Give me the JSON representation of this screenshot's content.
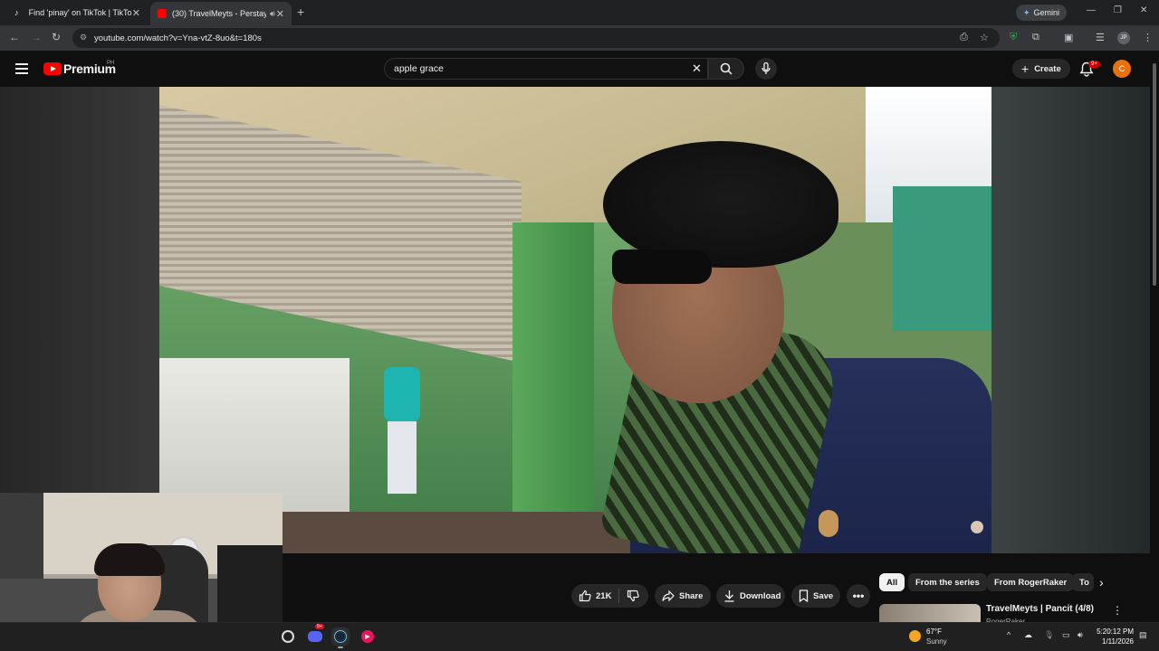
{
  "browser": {
    "tabs": [
      {
        "title": "Find 'pinay' on TikTok | TikTok S",
        "icon": "tiktok-icon",
        "active": false
      },
      {
        "title": "(30) TravelMeyts - Perstaym",
        "icon": "youtube-icon",
        "active": true
      }
    ],
    "gemini_label": "Gemini",
    "url": "youtube.com/watch?v=Yna-vtZ-8uo&t=180s",
    "profile_initials": "JP"
  },
  "youtube": {
    "logo_text": "Premium",
    "region": "PH",
    "search_value": "apple grace",
    "create_label": "Create",
    "notif_badge": "9+",
    "avatar_letter": "C"
  },
  "actions": {
    "likes": "21K",
    "share": "Share",
    "download": "Download",
    "save": "Save"
  },
  "chips": [
    "All",
    "From the series",
    "From RogerRaker",
    "To"
  ],
  "related": {
    "title": "TravelMeyts | Pancit  (4/8)",
    "channel": "RogerRaker"
  },
  "taskbar": {
    "discord_badge": "9+",
    "weather_temp": "67°F",
    "weather_desc": "Sunny",
    "time": "5:20:12 PM",
    "date": "1/11/2026"
  },
  "colors": {
    "yt_red": "#ff0000",
    "bg": "#0f0f0f",
    "avatar": "#e8710a"
  }
}
